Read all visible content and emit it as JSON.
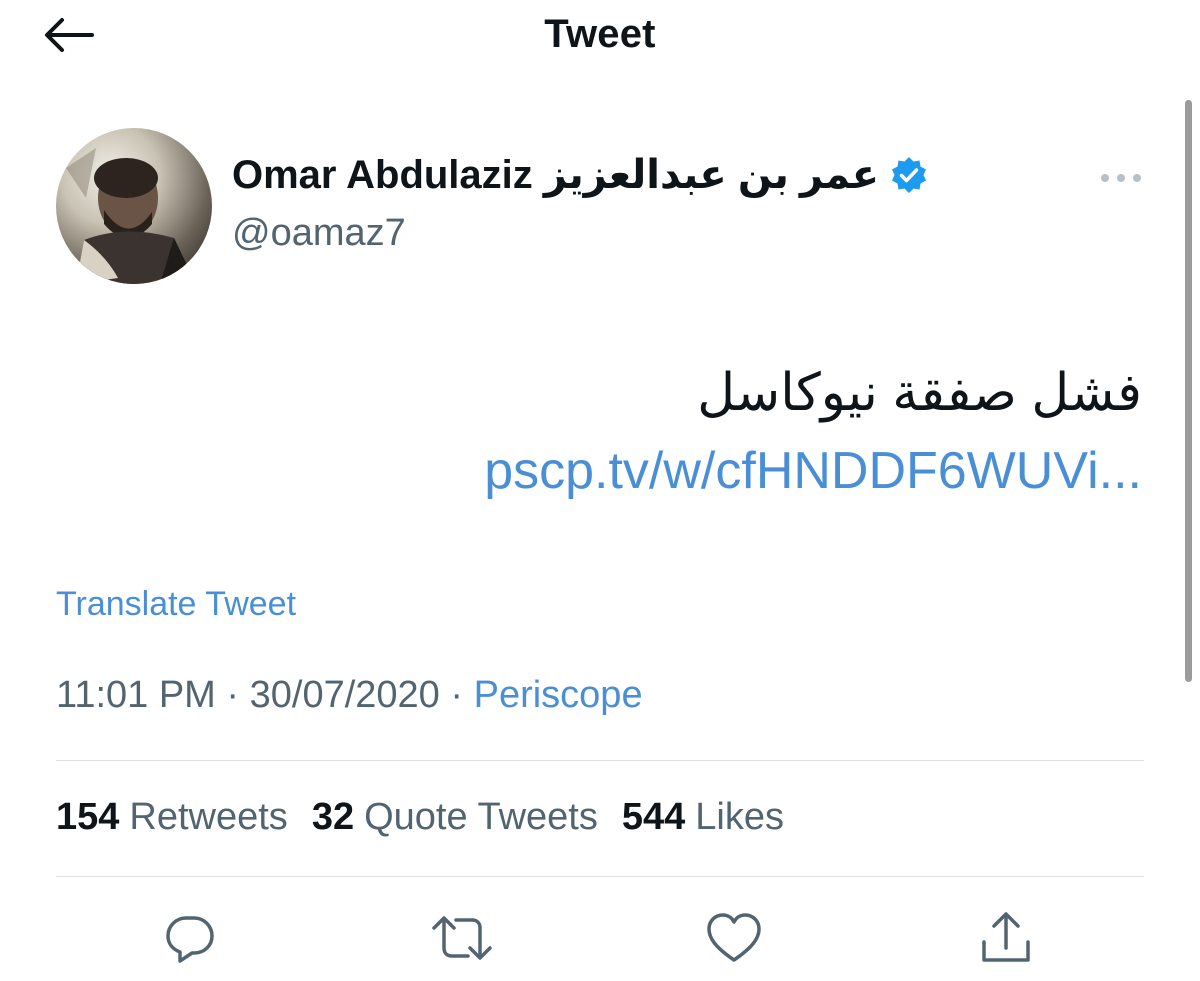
{
  "header": {
    "title": "Tweet",
    "back_icon": "arrow-left-icon"
  },
  "author": {
    "display_name": "Omar Abdulaziz عمر بن عبدالعزيز",
    "handle": "@oamaz7",
    "verified": true,
    "verified_color": "#1d9bf0"
  },
  "tweet": {
    "text_arabic": "فشل صفقة نيوكاسل",
    "link_line1": "pscp.tv/w/",
    "link_line2": "cfHNDDF6WUVi...",
    "translate_label": "Translate Tweet",
    "time": "11:01 PM",
    "date": "30/07/2020",
    "source": "Periscope",
    "separator": "·"
  },
  "stats": {
    "retweets_count": "154",
    "retweets_label": "Retweets",
    "quotes_count": "32",
    "quotes_label": "Quote Tweets",
    "likes_count": "544",
    "likes_label": "Likes"
  },
  "actions": [
    "reply-icon",
    "retweet-icon",
    "like-icon",
    "share-icon"
  ],
  "colors": {
    "link": "#4a8fd6",
    "secondary_text": "#536471",
    "primary_text": "#0f1419",
    "icon": "#536471"
  }
}
